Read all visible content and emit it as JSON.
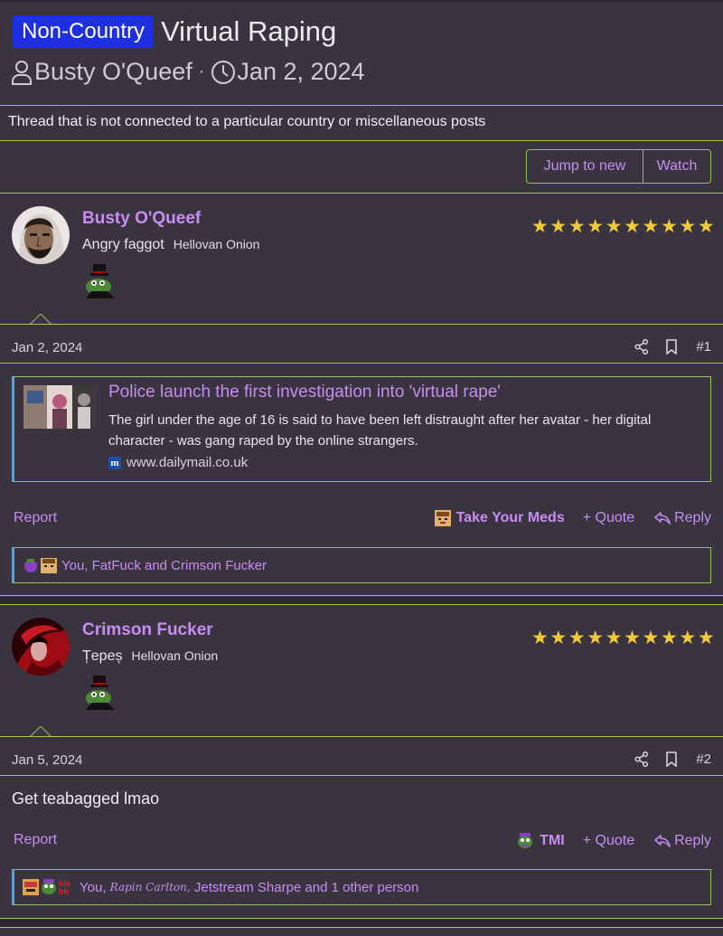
{
  "thread": {
    "prefix": "Non-Country",
    "title": "Virtual Raping",
    "author": "Busty O'Queef",
    "separator": "·",
    "date": "Jan 2, 2024",
    "description": "Thread that is not connected to a particular country or miscellaneous posts"
  },
  "toolbar": {
    "jump_label": "Jump to new",
    "watch_label": "Watch"
  },
  "colors": {
    "accent": "#c88df0",
    "border": "#9cc05c",
    "prefix_bg": "#1d2fe0",
    "background": "#3a3340"
  },
  "posts": [
    {
      "username": "Busty O'Queef",
      "user_title": "Angry faggot",
      "banner": "Hellovan Onion",
      "stars": "★★★★★★★★★★",
      "date": "Jan 2, 2024",
      "number": "#1",
      "embed": {
        "title": "Police launch the first investigation into 'virtual rape'",
        "text": "The girl under the age of 16 is said to have been left distraught after her avatar - her digital character - was gang raped by the online strangers.",
        "source_icon": "m",
        "source": "www.dailymail.co.uk"
      },
      "report": "Report",
      "reaction": "Take Your Meds",
      "quote": "+ Quote",
      "reply": "Reply",
      "likes": "You, FatFuck and Crimson Fucker"
    },
    {
      "username": "Crimson Fucker",
      "user_title": "Țepeș",
      "banner": "Hellovan Onion",
      "stars": "★★★★★★★★★★",
      "date": "Jan 5, 2024",
      "number": "#2",
      "body": "Get teabagged lmao",
      "report": "Report",
      "reaction": "TMI",
      "quote": "+ Quote",
      "reply": "Reply",
      "likes_prefix": "You,",
      "likes_sig": "Rapin Carlton,",
      "likes_rest": "Jetstream Sharpe and 1 other person",
      "reaction_icon_text": "his\nbh"
    }
  ]
}
